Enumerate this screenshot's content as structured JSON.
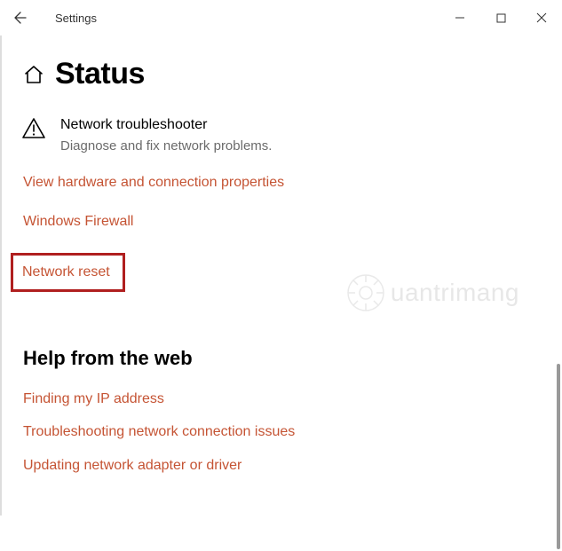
{
  "titlebar": {
    "title": "Settings"
  },
  "page": {
    "title": "Status"
  },
  "troubleshooter": {
    "title": "Network troubleshooter",
    "desc": "Diagnose and fix network problems."
  },
  "links": {
    "view_props": "View hardware and connection properties",
    "firewall": "Windows Firewall",
    "reset": "Network reset"
  },
  "help": {
    "heading": "Help from the web",
    "items": [
      "Finding my IP address",
      "Troubleshooting network connection issues",
      "Updating network adapter or driver"
    ]
  },
  "watermark": {
    "text": "uantrimang"
  }
}
